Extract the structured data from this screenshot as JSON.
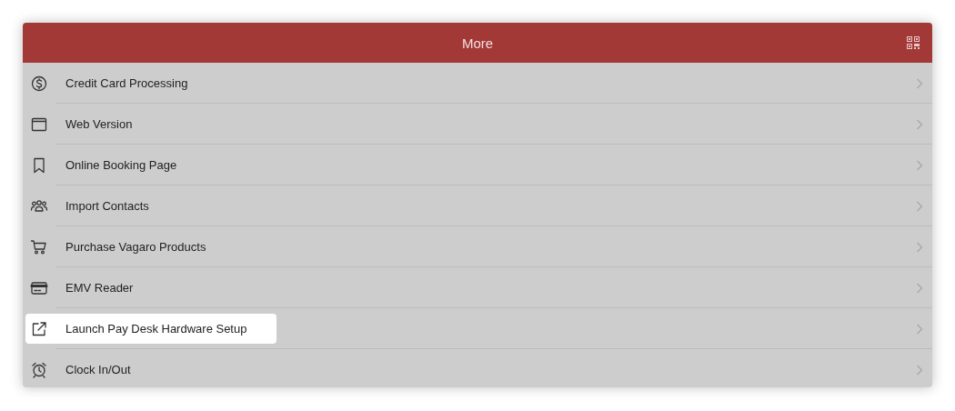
{
  "header": {
    "title": "More"
  },
  "items": [
    {
      "label": "Credit Card Processing",
      "selected": false
    },
    {
      "label": "Web Version",
      "selected": false
    },
    {
      "label": "Online Booking Page",
      "selected": false
    },
    {
      "label": "Import Contacts",
      "selected": false
    },
    {
      "label": "Purchase Vagaro Products",
      "selected": false
    },
    {
      "label": "EMV Reader",
      "selected": false
    },
    {
      "label": "Launch Pay Desk Hardware Setup",
      "selected": true
    },
    {
      "label": "Clock In/Out",
      "selected": false
    }
  ]
}
